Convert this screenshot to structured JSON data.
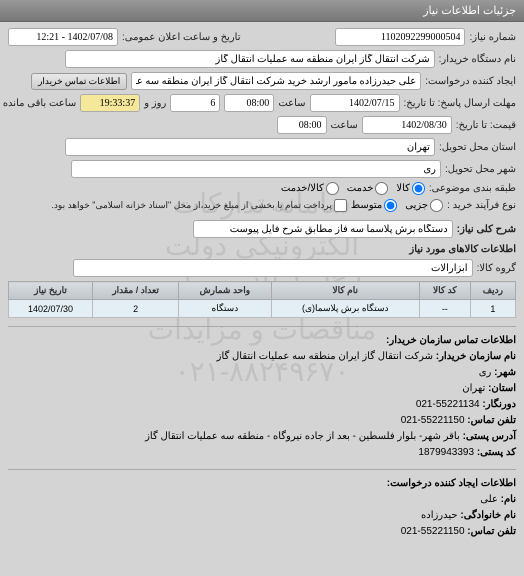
{
  "header": {
    "title": "جزئیات اطلاعات نیاز"
  },
  "fields": {
    "need_number_label": "شماره نیاز:",
    "need_number": "1102092299000504",
    "announce_label": "تاریخ و ساعت اعلان عمومی:",
    "announce_value": "1402/07/08 - 12:21",
    "buyer_device_label": "نام دستگاه خریدار:",
    "buyer_device": "شرکت انتقال گاز ایران منطقه سه عملیات انتقال گاز",
    "requester_label": "ایجاد کننده درخواست:",
    "requester": "علی حیدرزاده مامور ارشد خرید شرکت انتقال گاز ایران منطقه سه عملیات انتقال",
    "contact_btn": "اطلاعات تماس خریدار",
    "deadline_label": "مهلت ارسال پاسخ: تا تاریخ:",
    "deadline_date": "1402/07/15",
    "deadline_time_label": "ساعت",
    "deadline_time": "08:00",
    "days_count": "6",
    "days_label": "روز و",
    "remaining_time": "19:33:37",
    "remaining_label": "ساعت باقی مانده",
    "price_label": "قیمت: تا تاریخ:",
    "price_date": "1402/08/30",
    "price_time": "08:00",
    "province_label": "استان محل تحویل:",
    "province": "تهران",
    "city_label": "شهر محل تحویل:",
    "city": "ری",
    "category_label": "طبقه بندی موضوعی:",
    "radio_goods": "کالا",
    "radio_service": "خدمت",
    "radio_goods_service": "کالا/خدمت",
    "process_label": "نوع فرآیند خرید :",
    "radio_partial": "جزیی",
    "radio_medium": "متوسط",
    "process_note": "پرداخت تمام یا بخشی از مبلغ خرید،از محل \"اسناد خزانه اسلامی\" خواهد بود.",
    "need_title_label": "شرح کلی نیاز:",
    "need_title": "دستگاه برش پلاسما سه فاز مطابق شرح فایل پیوست",
    "goods_info_title": "اطلاعات کالاهای مورد نیاز",
    "goods_group_label": "گروه کالا:",
    "goods_group": "ابزارآلات"
  },
  "table": {
    "headers": [
      "ردیف",
      "کد کالا",
      "نام کالا",
      "واحد شمارش",
      "تعداد / مقدار",
      "تاریخ نیاز"
    ],
    "row": {
      "index": "1",
      "code": "--",
      "name": "دستگاه برش پلاسما(ی)",
      "unit": "دستگاه",
      "qty": "2",
      "date": "1402/07/30"
    }
  },
  "contact_buyer": {
    "title": "اطلاعات تماس سازمان خریدار:",
    "org_label": "نام سازمان خریدار:",
    "org": "شرکت انتقال گاز ایران منطقه سه عملیات انتقال گاز",
    "city_label": "شهر:",
    "city": "ری",
    "province_label": "استان:",
    "province": "تهران",
    "fax_label": "دورنگار:",
    "fax": "55221134-021",
    "phone_label": "تلفن تماس:",
    "phone": "55221150-021",
    "postal_label": "آدرس پستی:",
    "postal": "باقر شهر- بلوار فلسطین - بعد از جاده نیروگاه - منطقه سه عملیات انتقال گاز",
    "zip_label": "کد پستی:",
    "zip": "1879943393"
  },
  "contact_requester": {
    "title": "اطلاعات ایجاد کننده درخواست:",
    "name_label": "نام:",
    "name": "علی",
    "family_label": "نام خانوادگی:",
    "family": "حیدرزاده",
    "phone_label": "تلفن تماس:",
    "phone": "55221150-021"
  },
  "watermark": {
    "line1": "سامانه تدارکات الکترونیکی دولت",
    "line2": "پایگاه اطلاع رسانی مناقصات و مزایدات",
    "line3": "۰۲۱-۸۸۲۴۹۶۷۰"
  }
}
